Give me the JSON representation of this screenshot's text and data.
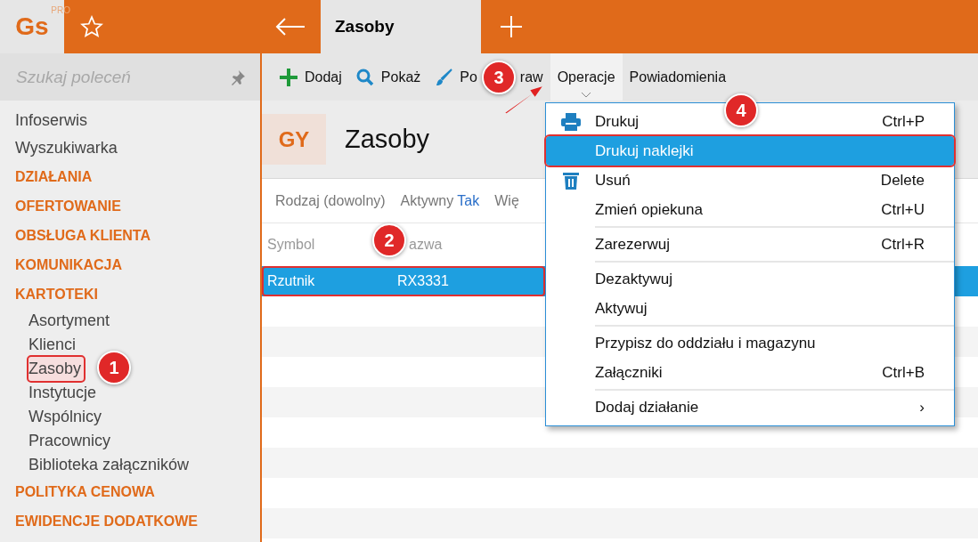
{
  "logo": {
    "text": "Gs",
    "badge": "PRO"
  },
  "tabs": [
    {
      "label": "Zasoby",
      "selected": true
    }
  ],
  "sidebar": {
    "search": {
      "placeholder": "Szukaj poleceń"
    },
    "items": [
      {
        "kind": "link",
        "label": "Infoserwis"
      },
      {
        "kind": "link",
        "label": "Wyszukiwarka"
      },
      {
        "kind": "section",
        "label": "DZIAŁANIA"
      },
      {
        "kind": "section",
        "label": "OFERTOWANIE"
      },
      {
        "kind": "section",
        "label": "OBSŁUGA KLIENTA"
      },
      {
        "kind": "section",
        "label": "KOMUNIKACJA"
      },
      {
        "kind": "section",
        "label": "KARTOTEKI",
        "children": [
          {
            "label": "Asortyment",
            "highlighted": false
          },
          {
            "label": "Klienci",
            "highlighted": false
          },
          {
            "label": "Zasoby",
            "highlighted": true
          },
          {
            "label": "Instytucje",
            "highlighted": false
          },
          {
            "label": "Wspólnicy",
            "highlighted": false
          },
          {
            "label": "Pracownicy",
            "highlighted": false
          },
          {
            "label": "Biblioteka załączników",
            "highlighted": false
          }
        ]
      },
      {
        "kind": "section",
        "label": "POLITYKA CENOWA"
      },
      {
        "kind": "section",
        "label": "EWIDENCJE DODATKOWE"
      }
    ]
  },
  "toolbar": [
    {
      "kind": "plus",
      "label": "Dodaj",
      "selected": false
    },
    {
      "kind": "search",
      "label": "Pokaż",
      "selected": false
    },
    {
      "kind": "brush",
      "label": "Po",
      "label_after": "raw",
      "selected": false
    },
    {
      "kind": "dropdown",
      "label": "Operacje",
      "selected": true
    },
    {
      "kind": "text",
      "label": "Powiadomienia",
      "selected": false
    }
  ],
  "header": {
    "badge": "GY",
    "title": "Zasoby"
  },
  "filters": [
    {
      "label": "Rodzaj (dowolny)"
    },
    {
      "label": "Aktywny",
      "value": "Tak"
    },
    {
      "label": "Wię"
    }
  ],
  "table": {
    "columns": [
      "Symbol",
      "azwa"
    ],
    "rows": [
      {
        "cells": [
          "Rzutnik",
          "RX3331"
        ],
        "selected": true,
        "highlighted": true
      }
    ]
  },
  "menu": {
    "groups": [
      [
        {
          "kind": "print",
          "label": "Drukuj",
          "shortcut": "Ctrl+P",
          "selected": false,
          "highlighted": false
        },
        {
          "label": "Drukuj naklejki",
          "selected": true,
          "highlighted": true
        },
        {
          "kind": "delete",
          "label": "Usuń",
          "shortcut": "Delete",
          "selected": false,
          "highlighted": false
        },
        {
          "label": "Zmień opiekuna",
          "shortcut": "Ctrl+U",
          "selected": false,
          "highlighted": false
        }
      ],
      [
        {
          "label": "Zarezerwuj",
          "shortcut": "Ctrl+R",
          "selected": false,
          "highlighted": false
        }
      ],
      [
        {
          "label": "Dezaktywuj",
          "selected": false,
          "highlighted": false
        },
        {
          "label": "Aktywuj",
          "selected": false,
          "highlighted": false
        }
      ],
      [
        {
          "label": "Przypisz do oddziału i magazynu",
          "selected": false,
          "highlighted": false
        },
        {
          "label": "Załączniki",
          "shortcut": "Ctrl+B",
          "selected": false,
          "highlighted": false
        }
      ],
      [
        {
          "label": "Dodaj działanie",
          "submenu": "›",
          "selected": false,
          "highlighted": false
        }
      ]
    ]
  },
  "callouts": [
    "1",
    "2",
    "3",
    "4"
  ]
}
